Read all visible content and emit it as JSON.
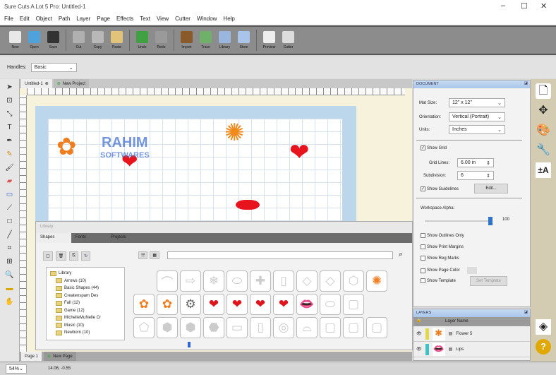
{
  "window": {
    "title": "Sure Cuts A Lot 5 Pro: Untitled-1",
    "minimize": "–",
    "maximize": "☐",
    "close": "✕"
  },
  "menu": [
    "File",
    "Edit",
    "Object",
    "Path",
    "Layer",
    "Page",
    "Effects",
    "Text",
    "View",
    "Cutter",
    "Window",
    "Help"
  ],
  "toolbar": [
    {
      "label": "New",
      "color": "#e8e8e8"
    },
    {
      "label": "Open",
      "color": "#4fa3dd"
    },
    {
      "label": "Save",
      "color": "#333333"
    },
    {
      "label": "Cut",
      "color": "#b0b0b0"
    },
    {
      "label": "Copy",
      "color": "#b8b8b8"
    },
    {
      "label": "Paste",
      "color": "#e1c37a"
    },
    {
      "label": "Undo",
      "color": "#3fa142"
    },
    {
      "label": "Redo",
      "color": "#9a9a9a"
    },
    {
      "label": "Import",
      "color": "#8a5a2b"
    },
    {
      "label": "Trace",
      "color": "#6fb06a"
    },
    {
      "label": "Library",
      "color": "#9ab6de"
    },
    {
      "label": "Store",
      "color": "#a8c4e8"
    },
    {
      "label": "Preview",
      "color": "#eeeeee"
    },
    {
      "label": "Cutter",
      "color": "#dddddd"
    }
  ],
  "handles": {
    "label": "Handles:",
    "value": "Basic"
  },
  "doc_tabs": [
    "Untitled-1",
    "New Project"
  ],
  "watermark": {
    "line1": "RAHIM",
    "line2": "SOFTWARES"
  },
  "library": {
    "title": "Library",
    "tabs": [
      "Shapes",
      "Fonts",
      "Projects"
    ],
    "tree": [
      "Library",
      "Arrows (10)",
      "Basic Shapes (44)",
      "Createnspam Des",
      "Fall (12)",
      "Game (12)",
      "MichelleMuNelle Cr",
      "Music (10)",
      "Newborn (10)"
    ]
  },
  "document": {
    "title": "DOCUMENT",
    "mat_size_label": "Mat Size:",
    "mat_size": "12\" x 12\"",
    "orientation_label": "Orientation:",
    "orientation": "Vertical (Portrait)",
    "units_label": "Units:",
    "units": "Inches",
    "show_grid": "Show Grid",
    "grid_lines_label": "Grid Lines:",
    "grid_lines": "6.00 in",
    "subdivision_label": "Subdivision:",
    "subdivision": "6",
    "show_guidelines": "Show Guidelines",
    "edit": "Edit...",
    "workspace_alpha": "Workspace Alpha:",
    "alpha_value": "100",
    "alpha_fraction": 1.0,
    "show_outlines": "Show Outlines Only",
    "show_print_margins": "Show Print Margins",
    "show_reg_marks": "Show Reg Marks",
    "show_page_color": "Show Page Color",
    "show_template": "Show Template",
    "set_template": "Set Template"
  },
  "layers": {
    "title": "LAYERS",
    "column": "Layer Name",
    "items": [
      {
        "name": "Flower 5",
        "color": "#e0d84a"
      },
      {
        "name": "Lips",
        "color": "#3cc4c4"
      }
    ]
  },
  "page_tabs": [
    "Page 1",
    "New Page"
  ],
  "status": {
    "zoom": "54%",
    "coords": "14.06, -0.55"
  }
}
